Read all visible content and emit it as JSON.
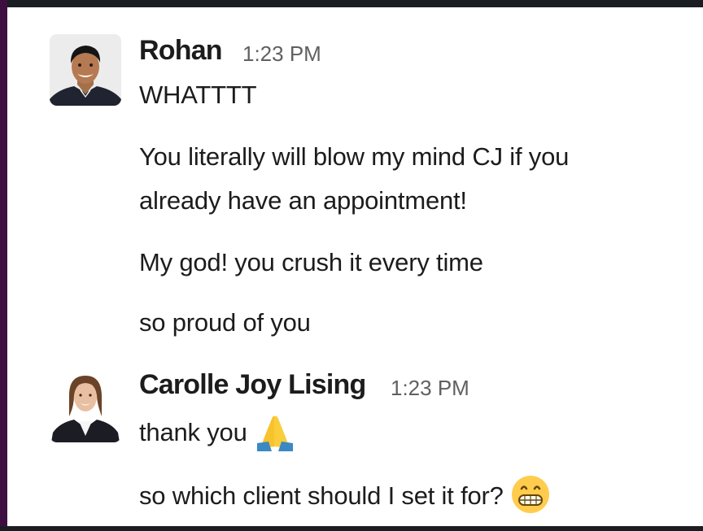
{
  "messages": [
    {
      "author": "Rohan",
      "time": "1:23 PM",
      "lines": [
        "WHATTTT",
        "You literally will blow my mind CJ if you",
        "already have an appointment!",
        "My god! you crush it every time",
        "so proud of you"
      ]
    },
    {
      "author": "Carolle Joy Lising",
      "time": "1:23 PM",
      "lines": [
        "thank you",
        "so which client should I set it for?"
      ],
      "emojis": [
        "folded-hands-icon",
        "grinning-face-icon"
      ]
    }
  ],
  "colors": {
    "sidebar_accent": "#3f0e40",
    "text": "#1d1c1d",
    "timestamp": "#616061"
  }
}
